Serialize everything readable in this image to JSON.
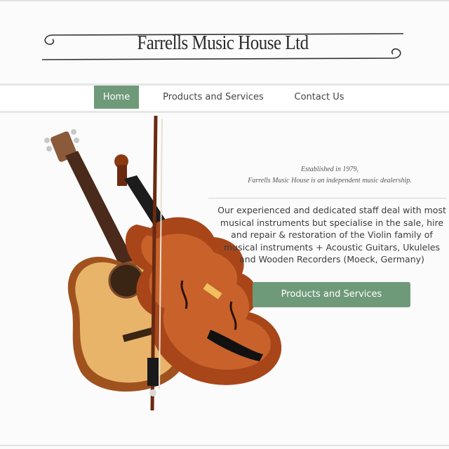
{
  "header": {
    "logo_text": "Farrells Music House Ltd"
  },
  "nav": {
    "items": [
      {
        "label": "Home",
        "active": true
      },
      {
        "label": "Products and Services",
        "active": false
      },
      {
        "label": "Contact Us",
        "active": false
      }
    ]
  },
  "hero": {
    "image": "guitar-and-violin-photo"
  },
  "intro": {
    "tagline_line1": "Established in 1979,",
    "tagline_line2": "Farrells Music House is an independent music dealership.",
    "description": "Our experienced and dedicated staff deal with most musical instruments but specialise in the sale, hire and repair & restoration of the Violin family of musical instruments + Acoustic Guitars, Ukuleles and Wooden Recorders (Moeck, Germany)",
    "cta_label": "Products and Services"
  },
  "colors": {
    "accent_green": "#6f9a7a",
    "text": "#3c3c3c",
    "nav_border": "#e6e6e6"
  }
}
